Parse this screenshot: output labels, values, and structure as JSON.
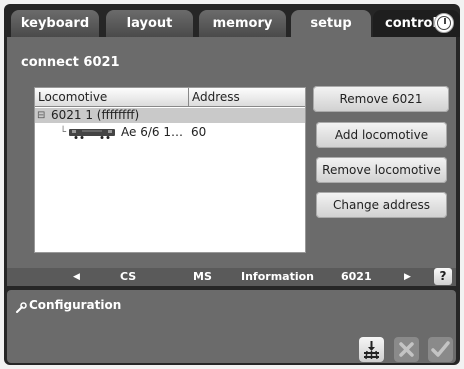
{
  "tabs": [
    {
      "label": "keyboard"
    },
    {
      "label": "layout"
    },
    {
      "label": "memory"
    },
    {
      "label": "setup"
    },
    {
      "label": "control"
    }
  ],
  "active_tab": "setup",
  "clock_icon": "clock-icon",
  "panel": {
    "title": "connect 6021"
  },
  "table": {
    "headers": [
      "Locomotive",
      "Address"
    ],
    "group": {
      "expander": "⊟",
      "name": "6021 1 (ffffffff)"
    },
    "rows": [
      {
        "name": "Ae 6/6 1…",
        "address": "60"
      }
    ]
  },
  "buttons": {
    "remove_6021": "Remove 6021",
    "add_locomotive": "Add locomotive",
    "remove_locomotive": "Remove locomotive",
    "change_address": "Change address"
  },
  "nav": {
    "left_arrow": "◀",
    "items": [
      "CS",
      "MS",
      "Information",
      "6021"
    ],
    "right_arrow": "▶",
    "help": "?"
  },
  "config": {
    "title": "Configuration"
  },
  "colors": {
    "background": "#262626",
    "panel": "#6b6b6b",
    "selection": "#c9c9c9"
  }
}
